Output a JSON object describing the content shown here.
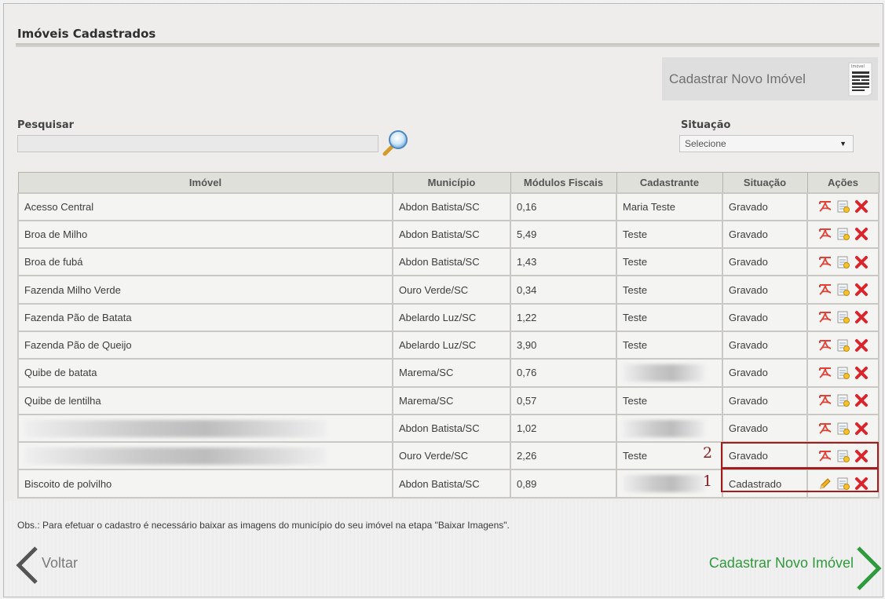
{
  "page": {
    "title": "Imóveis Cadastrados"
  },
  "new_button": {
    "label": "Cadastrar Novo Imóvel",
    "icon_caption": "Imóvel"
  },
  "search": {
    "label": "Pesquisar",
    "value": "",
    "placeholder": ""
  },
  "situacao_filter": {
    "label": "Situação",
    "selected": "Selecione"
  },
  "table": {
    "headers": {
      "imovel": "Imóvel",
      "municipio": "Município",
      "modulos": "Módulos Fiscais",
      "cadastrante": "Cadastrante",
      "situacao": "Situação",
      "acoes": "Ações"
    },
    "rows": [
      {
        "imovel": "Acesso Central",
        "municipio": "Abdon Batista/SC",
        "modulos": "0,16",
        "cadastrante": "Maria Teste",
        "situacao": "Gravado"
      },
      {
        "imovel": "Broa de Milho",
        "municipio": "Abdon Batista/SC",
        "modulos": "5,49",
        "cadastrante": "Teste",
        "situacao": "Gravado"
      },
      {
        "imovel": "Broa de fubá",
        "municipio": "Abdon Batista/SC",
        "modulos": "1,43",
        "cadastrante": "Teste",
        "situacao": "Gravado"
      },
      {
        "imovel": "Fazenda Milho Verde",
        "municipio": "Ouro Verde/SC",
        "modulos": "0,34",
        "cadastrante": "Teste",
        "situacao": "Gravado"
      },
      {
        "imovel": "Fazenda Pão de Batata",
        "municipio": "Abelardo Luz/SC",
        "modulos": "1,22",
        "cadastrante": "Teste",
        "situacao": "Gravado"
      },
      {
        "imovel": "Fazenda Pão de Queijo",
        "municipio": "Abelardo Luz/SC",
        "modulos": "3,90",
        "cadastrante": "Teste",
        "situacao": "Gravado"
      },
      {
        "imovel": "Quibe de batata",
        "municipio": "Marema/SC",
        "modulos": "0,76",
        "cadastrante": "",
        "situacao": "Gravado"
      },
      {
        "imovel": "Quibe de lentilha",
        "municipio": "Marema/SC",
        "modulos": "0,57",
        "cadastrante": "Teste",
        "situacao": "Gravado"
      },
      {
        "imovel": "",
        "municipio": "Abdon Batista/SC",
        "modulos": "1,02",
        "cadastrante": "",
        "situacao": "Gravado"
      },
      {
        "imovel": "",
        "municipio": "Ouro Verde/SC",
        "modulos": "2,26",
        "cadastrante": "Teste",
        "situacao": "Gravado"
      },
      {
        "imovel": "Biscoito de polvilho",
        "municipio": "Abdon Batista/SC",
        "modulos": "0,89",
        "cadastrante": "",
        "situacao": "Cadastrado"
      }
    ]
  },
  "annotations": {
    "marker_1": "1",
    "marker_2": "2"
  },
  "note": "Obs.: Para efetuar o cadastro é necessário baixar as imagens do município do seu imóvel na etapa \"Baixar Imagens\".",
  "nav": {
    "back_label": "Voltar",
    "next_label": "Cadastrar Novo Imóvel"
  },
  "colors": {
    "highlight": "#a61b1b",
    "next_green": "#2f9a3b",
    "delete_red": "#d9262c"
  }
}
